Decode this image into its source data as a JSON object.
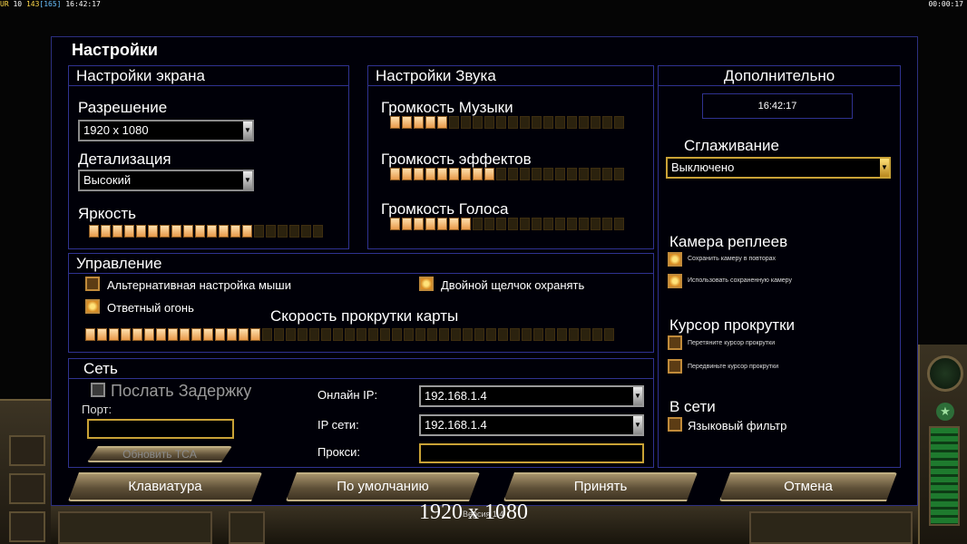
{
  "top_status": {
    "ur": "UR",
    "n1": "10",
    "n2": "143",
    "n3": "[165]",
    "clock": "16:42:17",
    "elapsed": "00:00:17"
  },
  "dialog": {
    "title": "Настройки"
  },
  "screen": {
    "header": "Настройки экрана",
    "resolution_label": "Разрешение",
    "resolution_value": "1920 x 1080",
    "detail_label": "Детализация",
    "detail_value": "Высокий",
    "brightness_label": "Яркость",
    "brightness_level": 0.71
  },
  "sound": {
    "header": "Настройки Звука",
    "music_label": "Громкость Музыки",
    "music_level": 0.26,
    "effects_label": "Громкость эффектов",
    "effects_level": 0.47,
    "voice_label": "Громкость Голоса",
    "voice_level": 0.37
  },
  "extra": {
    "header": "Дополнительно",
    "time": "16:42:17",
    "aa_label": "Сглаживание",
    "aa_value": "Выключено",
    "replay_camera_label": "Камера реплеев",
    "save_camera": "Сохранить камеру в повторах",
    "use_saved_camera": "Использовать сохраненную камеру",
    "scroll_cursor_label": "Курсор прокрутки",
    "drag_cursor": "Перетяните курсор прокрутки",
    "move_cursor": "Передвиньте курсор прокрутки",
    "online_label": "В сети",
    "lang_filter": "Языковый фильтр"
  },
  "control": {
    "header": "Управление",
    "alt_mouse": "Альтернативная настройка мыши",
    "double_click": "Двойной щелчок охранять",
    "retaliation": "Ответный огонь",
    "scroll_speed_label": "Скорость прокрутки карты",
    "scroll_speed_level": 0.33
  },
  "network": {
    "header": "Сеть",
    "send_delay": "Послать Задержку",
    "port_label": "Порт:",
    "update_tca": "Обновить TCA",
    "online_ip_label": "Онлайн IP:",
    "online_ip_value": "192.168.1.4",
    "lan_ip_label": "IP сети:",
    "lan_ip_value": "192.168.1.4",
    "proxy_label": "Прокси:"
  },
  "buttons": {
    "keyboard": "Клавиатура",
    "defaults": "По умолчанию",
    "accept": "Принять",
    "cancel": "Отмена"
  },
  "overlay": {
    "resolution": "1920 x 1080",
    "version": "Версия 1.4"
  }
}
